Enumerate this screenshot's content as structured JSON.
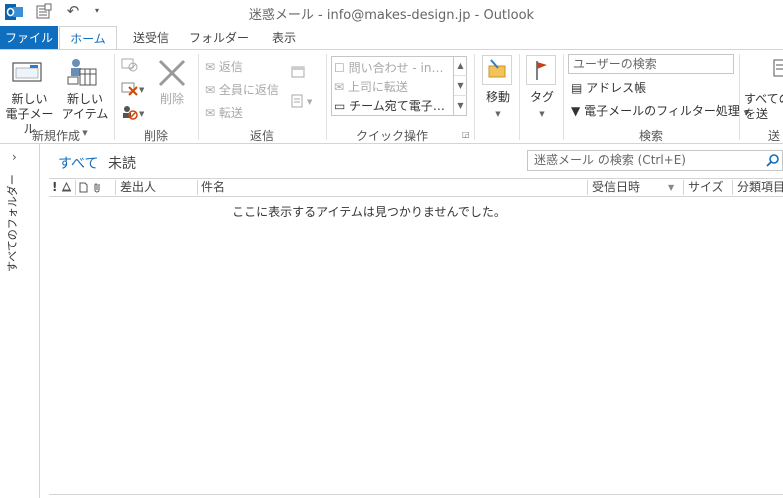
{
  "window": {
    "title": "迷惑メール - info@makes-design.jp - Outlook"
  },
  "tabs": [
    {
      "label": "ファイル"
    },
    {
      "label": "ホーム"
    },
    {
      "label": "送受信"
    },
    {
      "label": "フォルダー"
    },
    {
      "label": "表示"
    }
  ],
  "ribbon": {
    "new_group": {
      "label": "新規作成",
      "new_email": "新しい\n電子メール",
      "new_item": "新しい\nアイテム"
    },
    "delete_group": {
      "label": "削除",
      "delete": "削除"
    },
    "respond_group": {
      "label": "返信",
      "reply": "返信",
      "reply_all": "全員に返信",
      "forward": "転送"
    },
    "quick_steps_group": {
      "label": "クイック操作",
      "items": [
        "問い合わせ - in…",
        "上司に転送",
        "チーム宛て電子…"
      ]
    },
    "move_group": {
      "move": "移動",
      "tags": "タグ"
    },
    "find_group": {
      "label": "検索",
      "search_people_placeholder": "ユーザーの検索",
      "address_book": "アドレス帳",
      "filter_email": "電子メールのフィルター処理"
    },
    "send_receive_group": {
      "label": "送",
      "send_receive_all": "すべての\nを送"
    }
  },
  "navigation": {
    "all_folders": "すべてのフォルダー"
  },
  "mail_list": {
    "filter_all": "すべて",
    "filter_unread": "未読",
    "search_placeholder": "迷惑メール の検索 (Ctrl+E)",
    "columns": {
      "from": "差出人",
      "subject": "件名",
      "received": "受信日時",
      "size": "サイズ",
      "categories": "分類項目"
    },
    "empty_message": "ここに表示するアイテムは見つかりませんでした。"
  },
  "colors": {
    "accent": "#106ebe",
    "border": "#d4d4d4"
  }
}
